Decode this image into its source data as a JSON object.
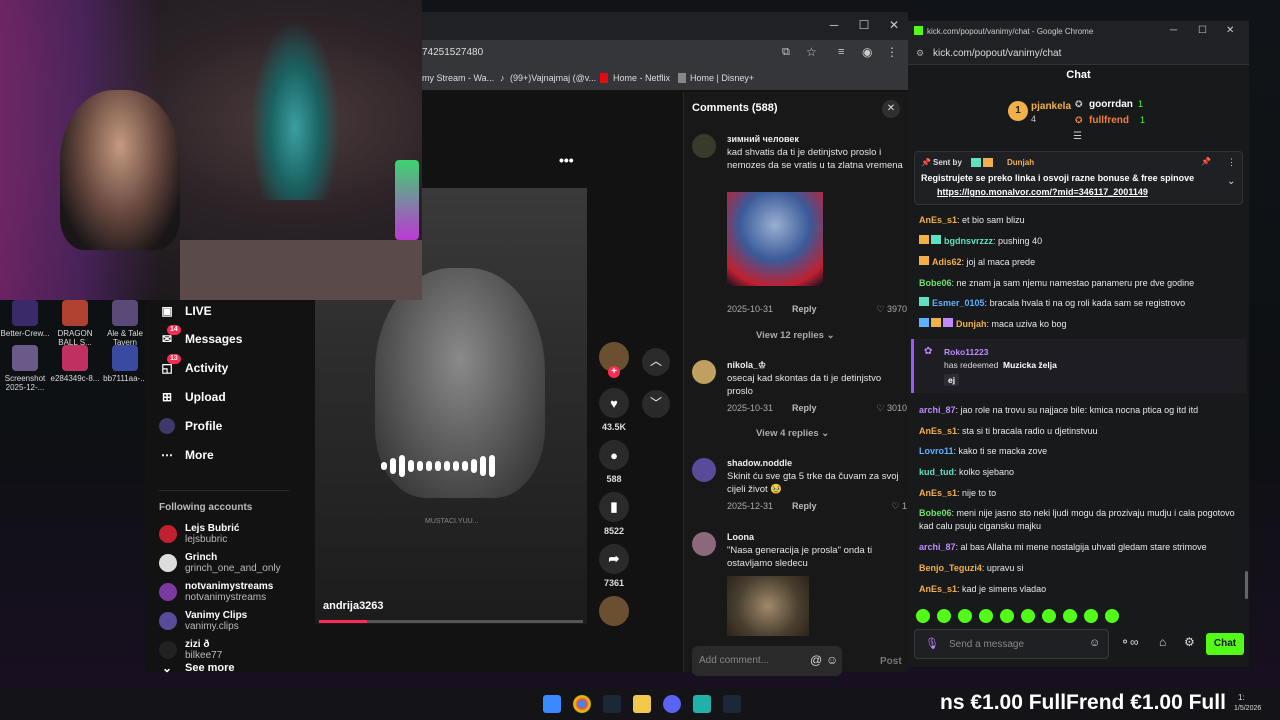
{
  "desktop": {
    "icons": [
      {
        "label": "Better-Crew..."
      },
      {
        "label": "DRAGON BALL S..."
      },
      {
        "label": "Ale & Tale Tavern"
      },
      {
        "label": "Screenshot 2025-12-..."
      },
      {
        "label": "e284349c-8..."
      },
      {
        "label": "bb7111aa-..."
      }
    ]
  },
  "tiktok": {
    "url_fragment": "74251527480",
    "bookmarks": [
      "my Stream - Wa...",
      "(99+)Vajnajmaj (@v...",
      "Home - Netflix",
      "Home | Disney+"
    ],
    "more_dots": "•••",
    "nav": [
      {
        "label": "LIVE"
      },
      {
        "label": "Messages",
        "badge": "14"
      },
      {
        "label": "Activity",
        "badge": "13"
      },
      {
        "label": "Upload"
      },
      {
        "label": "Profile"
      },
      {
        "label": "More"
      }
    ],
    "following_title": "Following accounts",
    "following": [
      {
        "name": "Lejs Bubrić",
        "handle": "lejsbubric"
      },
      {
        "name": "Grinch",
        "handle": "grinch_one_and_only"
      },
      {
        "name": "notvanimystreams",
        "handle": "notvanimystreams"
      },
      {
        "name": "Vanimy Clips",
        "handle": "vanimy.clips"
      },
      {
        "name": "zizi ð",
        "handle": "bilkee77"
      }
    ],
    "see_more": "See more",
    "video": {
      "author": "andrija3263",
      "watermark": "MUSTACI.YUU...",
      "progress": 0.18
    },
    "actions": [
      {
        "label": "43.5K"
      },
      {
        "label": "588"
      },
      {
        "label": "8522"
      },
      {
        "label": "7361"
      }
    ],
    "comments": {
      "title": "Comments (588)",
      "items": [
        {
          "name": "зимний человек",
          "text": "kad shvatis da ti je detinjstvo proslo i nemozes da se vratis u ta zlatna vremena",
          "date": "2025-10-31",
          "reply": "Reply",
          "likes": "3970",
          "view_replies": "View 12 replies"
        },
        {
          "name": "nikola_♔",
          "text": "osecaj kad skontas da ti je detinjstvo proslo",
          "date": "2025-10-31",
          "reply": "Reply",
          "likes": "3010",
          "view_replies": "View 4 replies"
        },
        {
          "name": "shadow.noddle",
          "text": "Skinit ću sve gta 5 trke da čuvam za svoj cijeli život 🥹",
          "date": "2025-12-31",
          "reply": "Reply",
          "likes": "1"
        },
        {
          "name": "Loona",
          "text": "\"Nasa generacija je prosla\" onda ti ostavljamo sledecu"
        }
      ],
      "input_placeholder": "Add comment...",
      "post": "Post"
    }
  },
  "kick": {
    "title": "kick.com/popout/vanimy/chat - Google Chrome",
    "url": "kick.com/popout/vanimy/chat",
    "header": "Chat",
    "leaderboard": [
      {
        "rank": "1",
        "name": "pjankela",
        "count": "4"
      },
      {
        "name": "goorrdan",
        "count": "1"
      },
      {
        "name": "fullfrend",
        "count": "1"
      }
    ],
    "pinned": {
      "sent_by": "Sent by",
      "user": "Dunjah",
      "text": "Registrujete se preko linka i osvoji razne bonuse & free spinove",
      "link": "https://lgno.monalvor.com/?mid=346117_2001149"
    },
    "messages": [
      {
        "user": "AnEs_s1",
        "color": "#f2b04a",
        "text": "et bio sam blizu"
      },
      {
        "user": "bgdnsvrzzz",
        "color": "#5fe0c0",
        "text": "pushing 40"
      },
      {
        "user": "Adis62",
        "color": "#f2b04a",
        "text": "joj al maca prede"
      },
      {
        "user": "Bobe06",
        "color": "#6fe06f",
        "text": "ne znam ja sam njemu namestao panameru pre dve godine"
      },
      {
        "user": "Esmer_0105",
        "color": "#5fb0ff",
        "text": "bracala hvala ti na og roli kada sam se registrovo"
      },
      {
        "user": "Dunjah",
        "color": "#f2b04a",
        "text": "maca uziva ko bog"
      },
      {
        "user": "archi_87",
        "color": "#c08bff",
        "text": "jao role na trovu su najjace bile: kmica nocna ptica og itd itd"
      },
      {
        "user": "AnEs_s1",
        "color": "#f2b04a",
        "text": "sta si ti bracala radio u djetinstvuu"
      },
      {
        "user": "Lovro11",
        "color": "#5fb0ff",
        "text": "kako ti se macka zove"
      },
      {
        "user": "kud_tud",
        "color": "#5fe0c0",
        "text": "kolko sjebano"
      },
      {
        "user": "AnEs_s1",
        "color": "#f2b04a",
        "text": "nije to to"
      },
      {
        "user": "Bobe06",
        "color": "#6fe06f",
        "text": "meni nije jasno sto neki ljudi mogu da prozivaju mudju i cala pogotovo kad calu psuju cigansku majku"
      },
      {
        "user": "archi_87",
        "color": "#c08bff",
        "text": "al bas Allaha mi mene nostalgija uhvati gledam stare strimove"
      },
      {
        "user": "Benjo_Teguzi4",
        "color": "#f2b04a",
        "text": "upravu si"
      },
      {
        "user": "AnEs_s1",
        "color": "#f2b04a",
        "text": "kad je simens vladao"
      }
    ],
    "redeem": {
      "user": "Roko11223",
      "action": "has redeemed",
      "reward": "Muzicka želja",
      "input": "ej"
    },
    "send_placeholder": "Send a message",
    "chat_button": "Chat"
  },
  "overlay": {
    "ticker": "ns  €1.00   FullFrend  €1.00   Full",
    "clock": "1:",
    "date": "1/5/2026"
  }
}
